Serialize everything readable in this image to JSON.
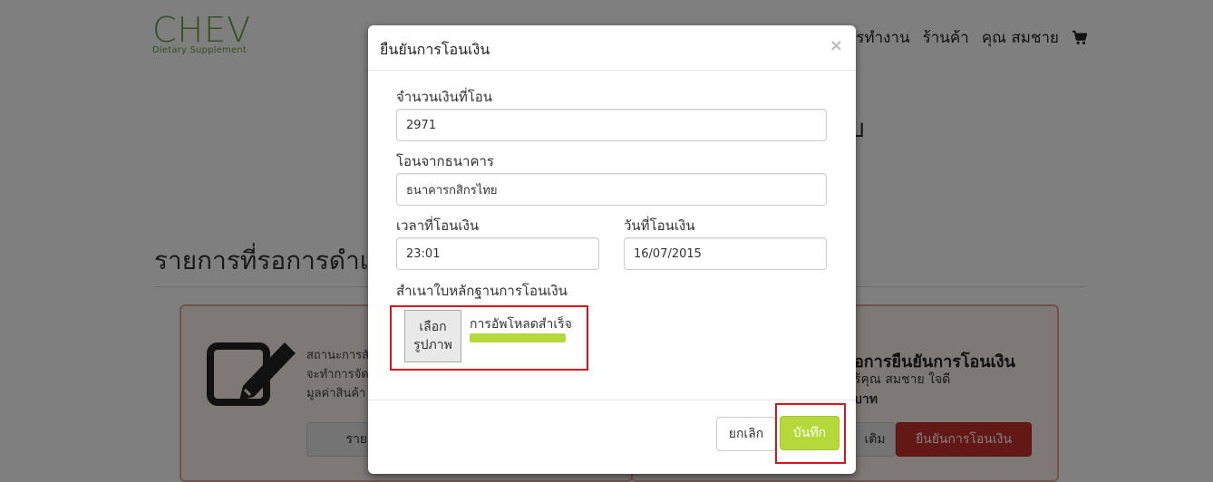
{
  "site": {
    "logo_main": "CHEV",
    "logo_sub": "Dietary Supplement",
    "nav": [
      "การทำงาน",
      "ร้านค้า",
      "คุณ สมชาย"
    ],
    "cart_icon": "shopping-cart-icon"
  },
  "background": {
    "heading": "รายการที่รอการดำเนิน",
    "title_fragment": "บ",
    "left_panel": {
      "icon": "edit-document-icon",
      "lines": [
        "สถานะการสั",
        "จะทำการจัด",
        "มูลค่าสินค้า"
      ],
      "button": "รายละเอี"
    },
    "right_panel": {
      "title": "อการยืนยันการโอนเงิน",
      "line1": "ร้คุณ สมชาย ใจดี",
      "line2": "บาท",
      "button_gray": "เติม",
      "button_red": "ยืนยันการโอนเงิน"
    }
  },
  "modal": {
    "title": "ยืนยันการโอนเงิน",
    "close": "×",
    "fields": {
      "amount": {
        "label": "จำนวนเงินที่โอน",
        "value": "2971"
      },
      "bank": {
        "label": "โอนจากธนาคาร",
        "value": "ธนาคารกสิกรไทย"
      },
      "time": {
        "label": "เวลาที่โอนเงิน",
        "value": "23:01"
      },
      "date": {
        "label": "วันที่โอนเงิน",
        "value": "16/07/2015"
      }
    },
    "upload": {
      "label": "สำเนาใบหลักฐานการโอนเงิน",
      "choose_line1": "เลือก",
      "choose_line2": "รูปภาพ",
      "status": "การอัพโหลดสำเร็จ",
      "progress": 1.0
    },
    "buttons": {
      "cancel": "ยกเลิก",
      "save": "บันทึก"
    }
  },
  "colors": {
    "accent_green": "#b5d93a",
    "brand_green": "#6aa03a",
    "highlight_red": "#d9131b",
    "confirm_red": "#c9302c"
  }
}
